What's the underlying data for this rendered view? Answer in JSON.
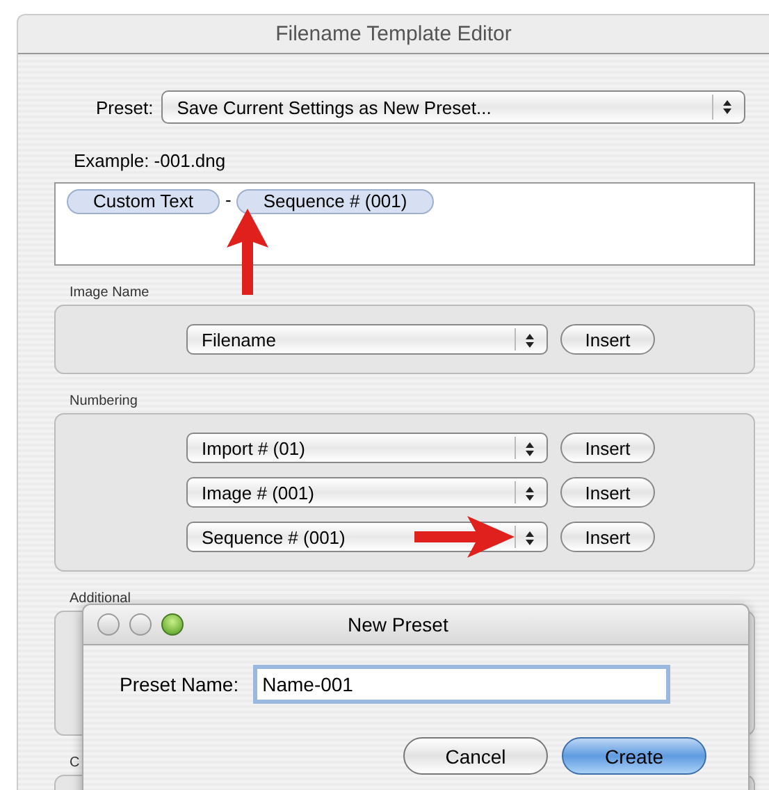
{
  "window": {
    "title": "Filename Template Editor"
  },
  "preset": {
    "label": "Preset:",
    "value": "Save Current Settings as New Preset..."
  },
  "example": "Example: -001.dng",
  "template_tokens": [
    {
      "kind": "token",
      "text": "Custom Text"
    },
    {
      "kind": "literal",
      "text": "-"
    },
    {
      "kind": "token",
      "text": "Sequence # (001)"
    }
  ],
  "groups": [
    {
      "label": "Image Name",
      "rows": [
        {
          "value": "Filename",
          "button": "Insert"
        }
      ]
    },
    {
      "label": "Numbering",
      "rows": [
        {
          "value": "Import # (01)",
          "button": "Insert"
        },
        {
          "value": "Image # (001)",
          "button": "Insert"
        },
        {
          "value": "Sequence # (001)",
          "button": "Insert"
        }
      ]
    },
    {
      "label": "Additional"
    },
    {
      "label": "C"
    }
  ],
  "dialog": {
    "title": "New Preset",
    "field_label": "Preset Name:",
    "field_value": "Name-001",
    "buttons": [
      {
        "label": "Cancel",
        "default": false
      },
      {
        "label": "Create",
        "default": true
      }
    ]
  }
}
